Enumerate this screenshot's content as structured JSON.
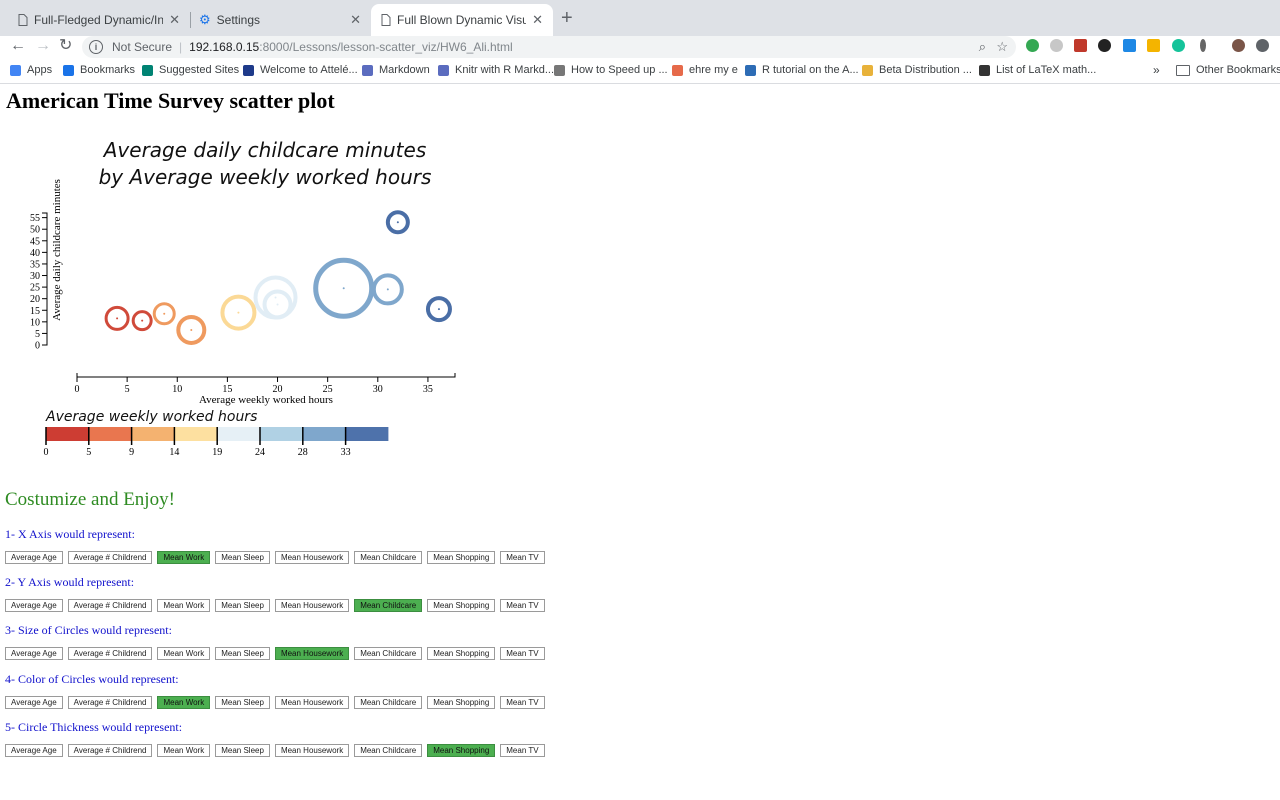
{
  "browser": {
    "tabs": [
      {
        "title": "Full-Fledged Dynamic/Interactive",
        "close": "✕"
      },
      {
        "title": "Settings",
        "close": "✕"
      },
      {
        "title": "Full Blown Dynamic Visualization",
        "close": "✕"
      }
    ],
    "new_tab": "+",
    "security_label": "Not Secure",
    "url_host": "192.168.0.15",
    "url_path": ":8000/Lessons/lesson-scatter_viz/HW6_Ali.html",
    "bookmarks": [
      {
        "label": "Apps",
        "icon": "apps-grid-icon",
        "color": "#4285f4"
      },
      {
        "label": "Bookmarks",
        "icon": "star-icon",
        "color": "#1a73e8"
      },
      {
        "label": "Suggested Sites",
        "icon": "bing-icon",
        "color": "#008373"
      },
      {
        "label": "Welcome to Attelé...",
        "icon": "mountain-icon",
        "color": "#1e3a8a"
      },
      {
        "label": "Markdown",
        "icon": "markdown-icon",
        "color": "#5b6cbf"
      },
      {
        "label": "Knitr with R Markd...",
        "icon": "knitr-icon",
        "color": "#5b6cbf"
      },
      {
        "label": "How to Speed up ...",
        "icon": "link-icon",
        "color": "#777777"
      },
      {
        "label": "ehre my e",
        "icon": "rainbow-icon",
        "color": "#e66a4a"
      },
      {
        "label": "R tutorial on the A...",
        "icon": "shield-icon",
        "color": "#2d6cb5"
      },
      {
        "label": "Beta Distribution ...",
        "icon": "hand-icon",
        "color": "#e8b23a"
      },
      {
        "label": "List of LaTeX math...",
        "icon": "latex-icon",
        "color": "#333333"
      }
    ],
    "bookmarks_overflow": "»",
    "other_bookmarks": "Other Bookmarks"
  },
  "page": {
    "title": "American Time Survey scatter plot",
    "customize_heading": "Costumize and Enjoy!",
    "options": [
      "Average Age",
      "Average # Childrend",
      "Mean Work",
      "Mean Sleep",
      "Mean Housework",
      "Mean Childcare",
      "Mean Shopping",
      "Mean TV"
    ],
    "controls": [
      {
        "label": "1- X Axis would represent:",
        "selected": "Mean Work"
      },
      {
        "label": "2- Y Axis would represent:",
        "selected": "Mean Childcare"
      },
      {
        "label": "3- Size of Circles would represent:",
        "selected": "Mean Housework"
      },
      {
        "label": "4- Color of Circles would represent:",
        "selected": "Mean Work"
      },
      {
        "label": "5- Circle Thickness would represent:",
        "selected": "Mean Shopping"
      }
    ]
  },
  "chart_data": {
    "type": "scatter",
    "title_lines": [
      "Average daily childcare minutes",
      "by Average weekly worked hours"
    ],
    "xlabel": "Average weekly worked hours",
    "ylabel": "Average daily childcare minutes",
    "xlim": [
      0,
      37.7
    ],
    "ylim": [
      0,
      57
    ],
    "x_ticks": [
      0,
      5,
      10,
      15,
      20,
      25,
      30,
      35
    ],
    "y_ticks": [
      0,
      5,
      10,
      15,
      20,
      25,
      30,
      35,
      40,
      45,
      50,
      55
    ],
    "grid": false,
    "points": [
      {
        "x": 4.0,
        "y": 11.5,
        "size": 11,
        "thickness": 3,
        "color": "#d04a3a"
      },
      {
        "x": 6.5,
        "y": 10.5,
        "size": 9,
        "thickness": 3,
        "color": "#d04a3a"
      },
      {
        "x": 8.7,
        "y": 13.5,
        "size": 10,
        "thickness": 3,
        "color": "#ef9a5f"
      },
      {
        "x": 11.4,
        "y": 6.5,
        "size": 13,
        "thickness": 4,
        "color": "#ef9a5f"
      },
      {
        "x": 16.1,
        "y": 14.0,
        "size": 16,
        "thickness": 4,
        "color": "#fbd996"
      },
      {
        "x": 19.8,
        "y": 20.5,
        "size": 20,
        "thickness": 4,
        "color": "#e1edf5"
      },
      {
        "x": 20.0,
        "y": 17.5,
        "size": 13,
        "thickness": 4,
        "color": "#e1edf5"
      },
      {
        "x": 26.6,
        "y": 24.5,
        "size": 28,
        "thickness": 5,
        "color": "#7fa7cc"
      },
      {
        "x": 31.0,
        "y": 24.0,
        "size": 14,
        "thickness": 4,
        "color": "#7fa7cc"
      },
      {
        "x": 32.0,
        "y": 53.0,
        "size": 10,
        "thickness": 4,
        "color": "#4a6ea6"
      },
      {
        "x": 36.1,
        "y": 15.5,
        "size": 11,
        "thickness": 4,
        "color": "#4a6ea6"
      }
    ],
    "legend": {
      "title": "Average weekly worked hours",
      "ticks": [
        "0",
        "5",
        "9",
        "14",
        "19",
        "24",
        "28",
        "33"
      ],
      "colors": [
        "#cd3d33",
        "#e9764f",
        "#f4b270",
        "#fde0a0",
        "#e6f0f6",
        "#b0d1e4",
        "#7fa7cc",
        "#4e72ab"
      ]
    }
  }
}
